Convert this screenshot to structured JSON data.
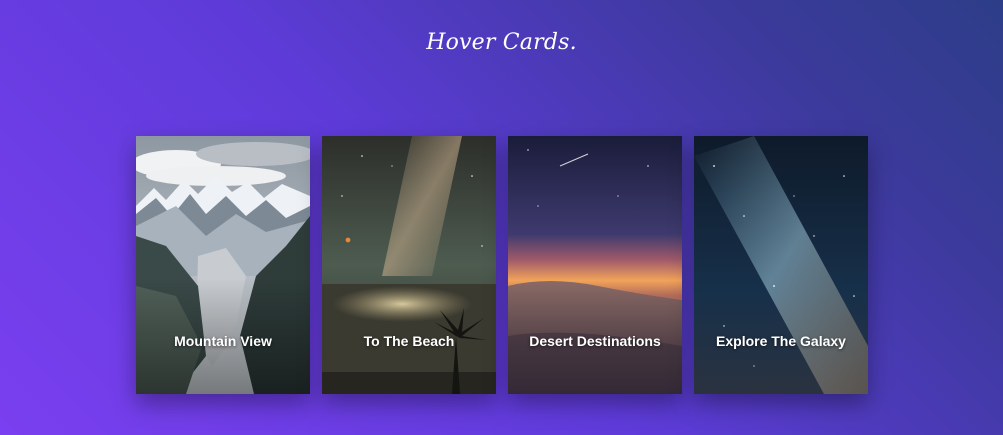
{
  "page": {
    "title": "Hover Cards."
  },
  "cards": [
    {
      "title": "Mountain View",
      "image": "snowy-mountain-valley"
    },
    {
      "title": "To The Beach",
      "image": "night-beach-milky-way"
    },
    {
      "title": "Desert Destinations",
      "image": "desert-dunes-sunset"
    },
    {
      "title": "Explore The Galaxy",
      "image": "milky-way-starfield"
    }
  ]
}
